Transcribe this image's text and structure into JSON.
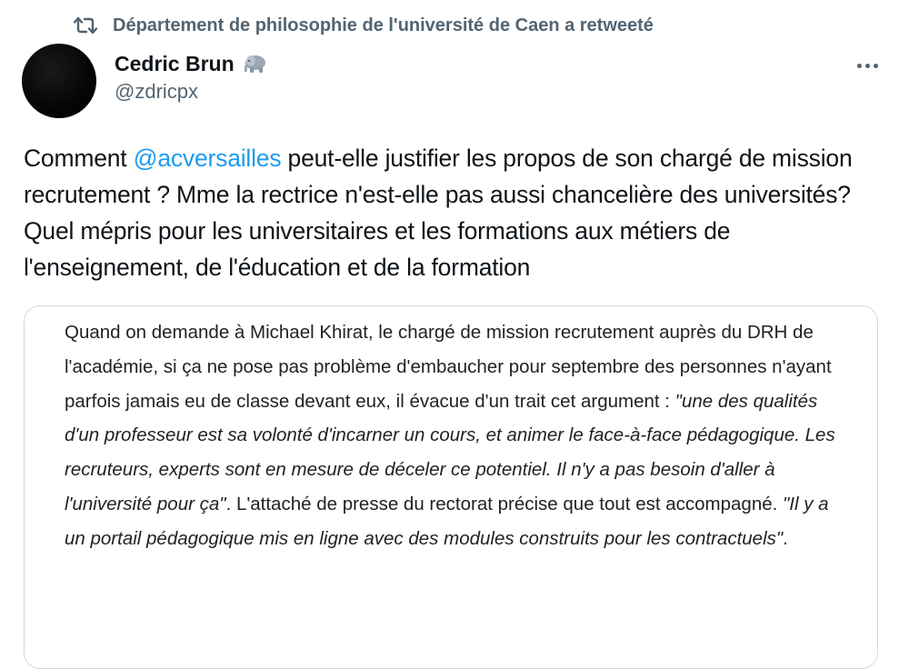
{
  "retweet": {
    "label": "Département de philosophie de l'université de Caen a retweeté",
    "icon": "retweet-icon"
  },
  "author": {
    "name": "Cedric Brun",
    "badge_icon": "elephant-icon",
    "handle": "@zdricpx"
  },
  "menu": {
    "icon": "more-icon"
  },
  "tweet": {
    "text_before": "Comment ",
    "mention": "@acversailles",
    "text_after": " peut-elle justifier les propos de son chargé de mission recrutement ? Mme la rectrice n'est-elle pas aussi chancelière des universités? Quel mépris pour les universitaires et les formations aux métiers de l'enseignement, de l'éducation et de la formation"
  },
  "quote": {
    "part1": "Quand on demande à Michael Khirat, le chargé de mission recrutement auprès du DRH de l'académie, si ça ne pose pas problème d'embaucher pour septembre des personnes n'ayant parfois jamais eu de classe devant eux, il évacue d'un trait cet argument : ",
    "quote1": "\"une des qualités d'un professeur est sa volonté d'incarner un cours, et animer le face-à-face pédagogique. Les recruteurs, experts sont en mesure de déceler ce potentiel. Il n'y a pas besoin d'aller à l'université pour ça\"",
    "part2": ". L'attaché de presse du rectorat précise que tout est accompagné. ",
    "quote2": "\"Il y a un portail pédagogique mis en ligne avec des modules construits pour les contractuels\"",
    "part3": "."
  },
  "colors": {
    "accent": "#1d9bf0",
    "secondary_text": "#536471",
    "primary_text": "#0f1419",
    "border": "#cfd9de"
  }
}
